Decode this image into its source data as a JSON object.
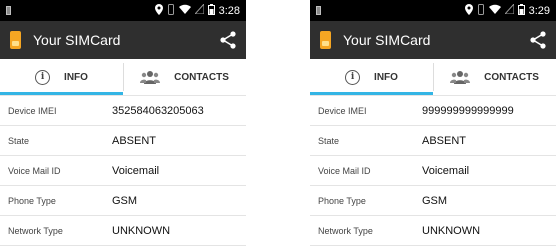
{
  "phones": [
    {
      "status_time": "3:28",
      "app_title": "Your SIMCard",
      "tabs": {
        "info": "INFO",
        "contacts": "CONTACTS"
      },
      "rows": [
        {
          "label": "Device IMEI",
          "value": "352584063205063"
        },
        {
          "label": "State",
          "value": "ABSENT"
        },
        {
          "label": "Voice Mail ID",
          "value": "Voicemail"
        },
        {
          "label": "Phone Type",
          "value": "GSM"
        },
        {
          "label": "Network Type",
          "value": "UNKNOWN"
        }
      ]
    },
    {
      "status_time": "3:29",
      "app_title": "Your SIMCard",
      "tabs": {
        "info": "INFO",
        "contacts": "CONTACTS"
      },
      "rows": [
        {
          "label": "Device IMEI",
          "value": "999999999999999"
        },
        {
          "label": "State",
          "value": "ABSENT"
        },
        {
          "label": "Voice Mail ID",
          "value": "Voicemail"
        },
        {
          "label": "Phone Type",
          "value": "GSM"
        },
        {
          "label": "Network Type",
          "value": "UNKNOWN"
        }
      ]
    }
  ],
  "icons": {
    "status": [
      "notification-icon",
      "location-icon",
      "vibrate-icon",
      "wifi-icon",
      "signal-icon",
      "battery-icon"
    ],
    "appbar": [
      "sim-card-logo-icon",
      "share-icon"
    ],
    "tabs": [
      "info-icon",
      "contacts-icon"
    ]
  },
  "colors": {
    "statusbar": "#000000",
    "appbar": "#2f2f2f",
    "tab_indicator": "#33b5e5",
    "logo": "#f5a623"
  }
}
